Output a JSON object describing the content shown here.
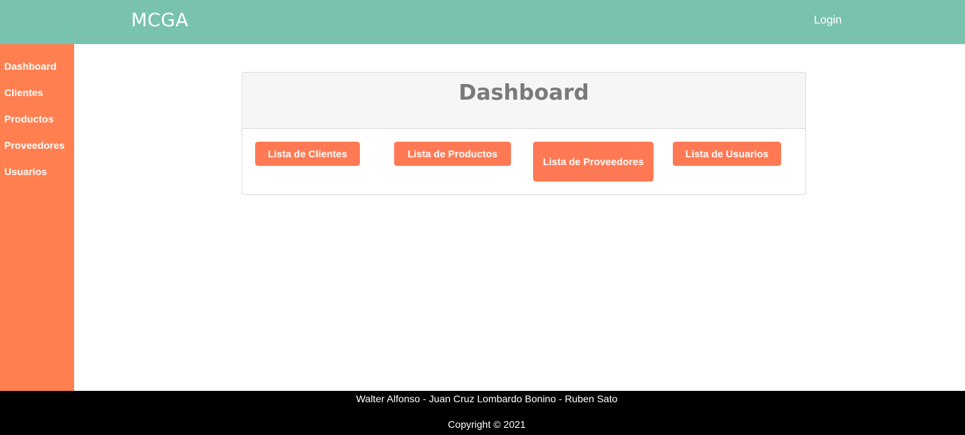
{
  "header": {
    "brand": "MCGA",
    "login_label": "Login"
  },
  "sidebar": {
    "items": [
      {
        "label": "Dashboard"
      },
      {
        "label": "Clientes"
      },
      {
        "label": "Productos"
      },
      {
        "label": "Proveedores"
      },
      {
        "label": "Usuarios"
      }
    ]
  },
  "main": {
    "card_title": "Dashboard",
    "buttons": [
      {
        "label": "Lista de Clientes"
      },
      {
        "label": "Lista de Productos"
      },
      {
        "label": "Lista de Proveedores"
      },
      {
        "label": "Lista de Usuarios"
      }
    ]
  },
  "footer": {
    "authors": "Walter Alfonso - Juan Cruz Lombardo Bonino - Ruben Sato",
    "copyright": "Copyright © 2021"
  },
  "colors": {
    "header_bg": "#79c3ae",
    "sidebar_bg": "#ff7f50",
    "button_bg": "#ff7a54",
    "footer_bg": "#000000"
  }
}
